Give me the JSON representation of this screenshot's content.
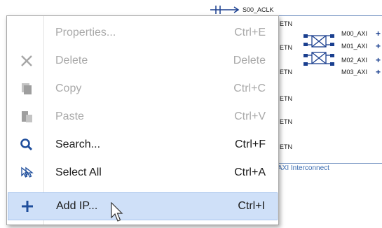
{
  "diagram": {
    "clock_label": "S00_ACLK",
    "left_ports": [
      "ETN",
      "ETN",
      "ETN",
      "ETN",
      "ETN",
      "ETN"
    ],
    "master_ports": [
      "M00_AXI",
      "M01_AXI",
      "M02_AXI",
      "M03_AXI"
    ],
    "block_title": "AXI Interconnect"
  },
  "context_menu": {
    "items": [
      {
        "label": "Properties...",
        "shortcut": "Ctrl+E",
        "icon": "none",
        "enabled": false
      },
      {
        "label": "Delete",
        "shortcut": "Delete",
        "icon": "close-icon",
        "enabled": false
      },
      {
        "label": "Copy",
        "shortcut": "Ctrl+C",
        "icon": "copy-icon",
        "enabled": false
      },
      {
        "label": "Paste",
        "shortcut": "Ctrl+V",
        "icon": "paste-icon",
        "enabled": false
      },
      {
        "label": "Search...",
        "shortcut": "Ctrl+F",
        "icon": "search-icon",
        "enabled": true
      },
      {
        "label": "Select All",
        "shortcut": "Ctrl+A",
        "icon": "select-all-icon",
        "enabled": true
      },
      {
        "label": "Add IP...",
        "shortcut": "Ctrl+I",
        "icon": "plus-icon",
        "enabled": true,
        "highlighted": true
      }
    ]
  },
  "colors": {
    "highlight": "#cfe0f8",
    "disabled_text": "#a9a9a9",
    "icon_blue": "#1f4e9c",
    "block_border": "#6f8fc0"
  }
}
